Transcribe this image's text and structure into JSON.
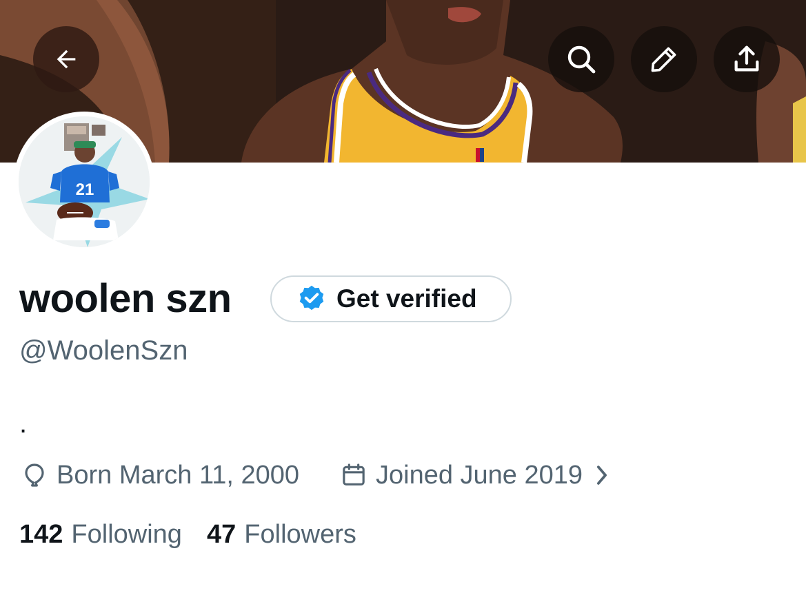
{
  "profile": {
    "display_name": "woolen szn",
    "handle": "@WoolenSzn",
    "bio": ".",
    "born": "Born March 11, 2000",
    "joined": "Joined June 2019",
    "following_count": "142",
    "following_label": "Following",
    "followers_count": "47",
    "followers_label": "Followers",
    "avatar_jersey_number": "21"
  },
  "verify": {
    "label": "Get verified"
  },
  "icons": {
    "back": "arrow-left-icon",
    "search": "search-icon",
    "edit": "pencil-icon",
    "share": "share-upload-icon",
    "verified": "verified-badge-icon",
    "birthday": "balloon-icon",
    "joined": "calendar-icon",
    "more": "chevron-right-icon"
  },
  "colors": {
    "text_primary": "#0f1419",
    "text_secondary": "#536471",
    "verified_blue": "#1d9bf0",
    "jersey_yellow": "#f5b92e",
    "jersey_purple": "#4a2a80"
  }
}
